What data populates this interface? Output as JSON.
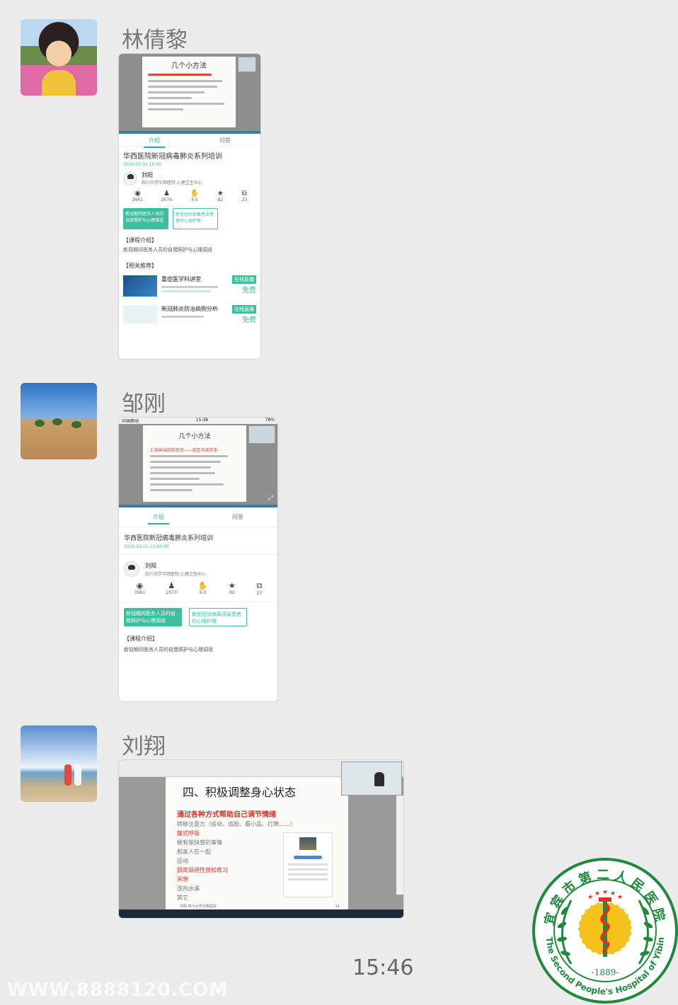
{
  "messages": [
    {
      "sender": "林倩黎",
      "card": {
        "slide_title": "几个小方法",
        "tabs": [
          "介绍",
          "问答"
        ],
        "course_title": "华西医院新冠病毒肺炎系列培训",
        "course_date": "2020-02-01 16:00",
        "teacher_name": "刘阳",
        "teacher_org": "四川大学华西医院 心理卫生中心",
        "stats": [
          "3961",
          "2076",
          "5.0",
          "82",
          "23"
        ],
        "tags": [
          "新冠期间医务人员的自我照护与心理调适",
          "新型冠状病毒感染患者的心理护理"
        ],
        "section_intro_head": "【课程介绍】",
        "section_intro_body": "新冠期间医务人员的自我照护与心理调适",
        "section_rec_head": "【相关推荐】",
        "rec1_title": "重症医学科讲堂",
        "rec1_badge": "在线直播",
        "rec1_free": "免费",
        "rec2_title": "新冠肺炎防治病例分析",
        "rec2_badge": "在线直播",
        "rec2_free": "免费"
      }
    },
    {
      "sender": "邹刚",
      "card": {
        "status_carrier": "中国移动",
        "status_time": "15:38",
        "status_battery": "78%",
        "slide_title": "几个小方法",
        "slide_heading": "2.接纳当前的状态——我至与他的手",
        "tabs": [
          "介绍",
          "问答"
        ],
        "course_title": "华西医院新冠病毒肺炎系列培训",
        "course_date": "2020-02-01 15:00:00",
        "teacher_name": "刘阳",
        "teacher_org": "四川大学华西医院 心理卫生中心",
        "stats": [
          "3961",
          "2073",
          "5.0",
          "82",
          "23"
        ],
        "tags": [
          "新冠期间医务人员的自我照护与心理调适",
          "新型冠状病毒感染患者的心理护理"
        ],
        "section_intro_head": "【课程介绍】",
        "section_intro_body": "新冠期间医务人员的自我照护与心理调适"
      }
    },
    {
      "sender": "刘翔",
      "card": {
        "slide_title": "四、积极调整身心状态",
        "bullets": [
          {
            "text": "通过各种方式帮助自己调节情绪",
            "color": "red"
          },
          {
            "text": "转移注意力（运动、追剧、看小品、打牌……）",
            "color": "gray"
          },
          {
            "text": "腹式呼吸",
            "color": "red"
          },
          {
            "text": "做有愉快感的事情",
            "color": "gray"
          },
          {
            "text": "和家人在一起",
            "color": "gray"
          },
          {
            "text": "运动",
            "color": "gray"
          },
          {
            "text": "肌肉渐进性放松练习",
            "color": "red"
          },
          {
            "text": "冥想",
            "color": "red"
          },
          {
            "text": "洗热水澡",
            "color": "gray"
          },
          {
            "text": "其它",
            "color": "gray"
          }
        ],
        "footer_left": "刘阳  四川大学华西医院",
        "footer_page": "11"
      }
    }
  ],
  "time_label": "15:46",
  "watermark": "WWW.8888120.COM",
  "logo": {
    "top_text": "宜宾市第二人民医院",
    "bottom_text": "The Second People's Hospital of Yibin",
    "year": "-1889-",
    "green": "#1f8a3c",
    "red": "#d9312b",
    "yellow": "#f3c31b"
  }
}
